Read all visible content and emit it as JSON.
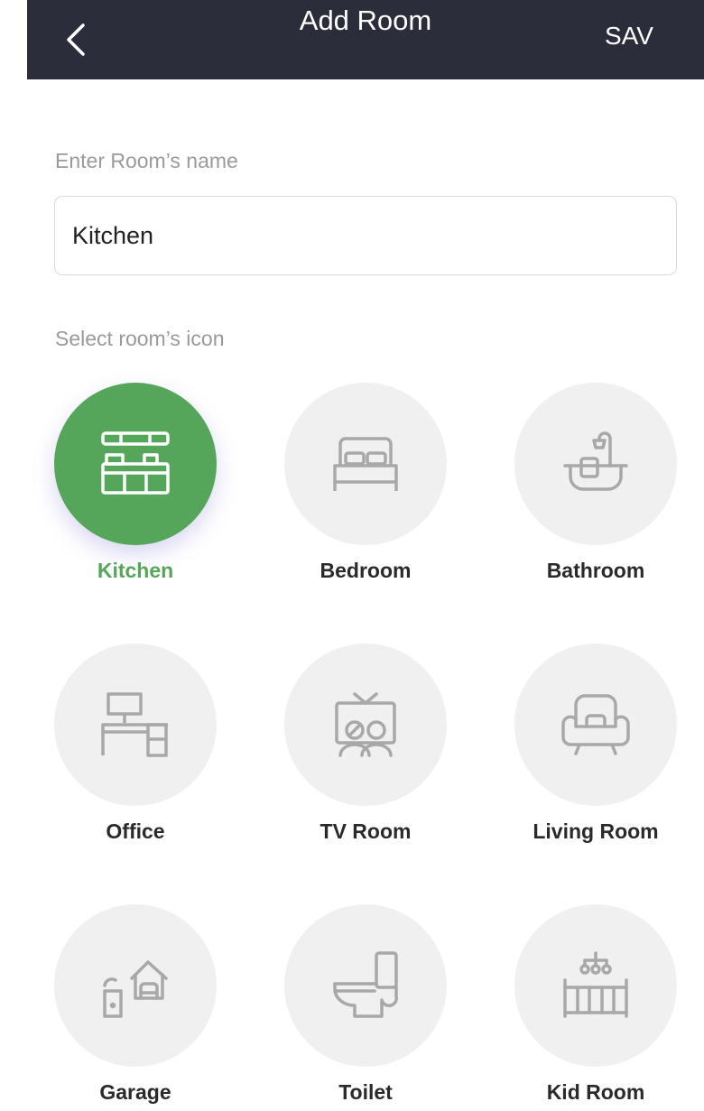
{
  "header": {
    "title": "Add Room",
    "save_label": "SAV",
    "back_icon": "chevron-left-icon",
    "background": "#2b2d3a"
  },
  "form": {
    "name_label": "Enter Room’s name",
    "name_value": "Kitchen",
    "icon_label": "Select room’s icon"
  },
  "colors": {
    "selected": "#55a65a",
    "tile_bg": "#f0f0f0",
    "icon_stroke": "#a8a8a8"
  },
  "rooms": [
    {
      "label": "Kitchen",
      "icon": "kitchen-icon",
      "selected": true
    },
    {
      "label": "Bedroom",
      "icon": "bed-icon",
      "selected": false
    },
    {
      "label": "Bathroom",
      "icon": "bathtub-icon",
      "selected": false
    },
    {
      "label": "Office",
      "icon": "desk-icon",
      "selected": false
    },
    {
      "label": "TV Room",
      "icon": "tv-icon",
      "selected": false
    },
    {
      "label": "Living Room",
      "icon": "armchair-icon",
      "selected": false
    },
    {
      "label": "Garage",
      "icon": "garage-icon",
      "selected": false
    },
    {
      "label": "Toilet",
      "icon": "toilet-icon",
      "selected": false
    },
    {
      "label": "Kid Room",
      "icon": "crib-icon",
      "selected": false
    }
  ]
}
